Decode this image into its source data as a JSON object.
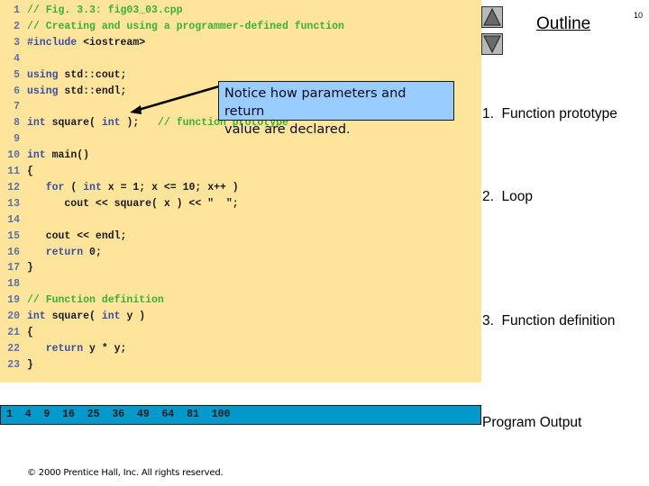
{
  "slide": {
    "page_number": "10",
    "outline_title": "Outline",
    "outline_items": [
      "1.  Function prototype",
      "2.  Loop",
      "3.  Function definition"
    ],
    "program_output_label": "Program Output",
    "copyright": "© 2000 Prentice Hall, Inc.  All rights reserved.",
    "colors": {
      "code_background": "#ffe59b",
      "callout_background": "#99ccff",
      "output_background": "#0099cc",
      "keyword": "#3a4ea0",
      "comment": "#39b039",
      "line_number": "#5a72a8"
    }
  },
  "nav": {
    "up_icon": "triangle-up-icon",
    "down_icon": "triangle-down-icon"
  },
  "code": {
    "lines": [
      {
        "n": "1",
        "text": "// Fig. 3.3: fig03_03.cpp"
      },
      {
        "n": "2",
        "text": "// Creating and using a programmer-defined function"
      },
      {
        "n": "3",
        "text": "#include <iostream>"
      },
      {
        "n": "4",
        "text": ""
      },
      {
        "n": "5",
        "text": "using std::cout;"
      },
      {
        "n": "6",
        "text": "using std::endl;"
      },
      {
        "n": "7",
        "text": ""
      },
      {
        "n": "8",
        "text": "int square( int );   // function prototype"
      },
      {
        "n": "9",
        "text": ""
      },
      {
        "n": "10",
        "text": "int main()"
      },
      {
        "n": "11",
        "text": "{"
      },
      {
        "n": "12",
        "text": "   for ( int x = 1; x <= 10; x++ )"
      },
      {
        "n": "13",
        "text": "      cout << square( x ) << \"  \";"
      },
      {
        "n": "14",
        "text": ""
      },
      {
        "n": "15",
        "text": "   cout << endl;"
      },
      {
        "n": "16",
        "text": "   return 0;"
      },
      {
        "n": "17",
        "text": "}"
      },
      {
        "n": "18",
        "text": ""
      },
      {
        "n": "19",
        "text": "// Function definition"
      },
      {
        "n": "20",
        "text": "int square( int y )"
      },
      {
        "n": "21",
        "text": "{"
      },
      {
        "n": "22",
        "text": "   return y * y;"
      },
      {
        "n": "23",
        "text": "}"
      }
    ]
  },
  "callout": {
    "line1": "Notice how parameters and return",
    "line2": "value are declared."
  },
  "output": {
    "text": "1  4  9  16  25  36  49  64  81  100"
  }
}
